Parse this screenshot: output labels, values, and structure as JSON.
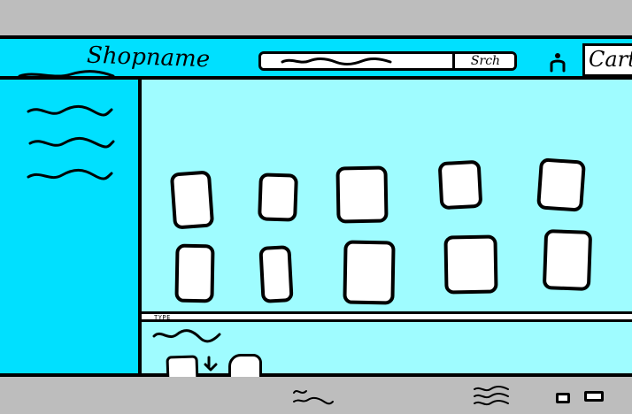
{
  "header": {
    "shop_name": "Shopname",
    "search": {
      "placeholder": "",
      "button_label": "Srch"
    },
    "cart_label": "Cart",
    "account_icon": "person-icon"
  },
  "sidebar": {
    "items": [
      {
        "label": ""
      },
      {
        "label": ""
      },
      {
        "label": ""
      }
    ]
  },
  "main": {
    "product_grid": {
      "rows": 2,
      "columns": 5
    },
    "type_label": "TYPE"
  },
  "footer": {
    "text_1": "",
    "text_2": ""
  },
  "colors": {
    "outer_background": "#bdbdbd",
    "header_and_sidebar": "#00e0ff",
    "content_area": "#9ffcff",
    "tile_fill": "#ffffff",
    "stroke": "#000000"
  }
}
